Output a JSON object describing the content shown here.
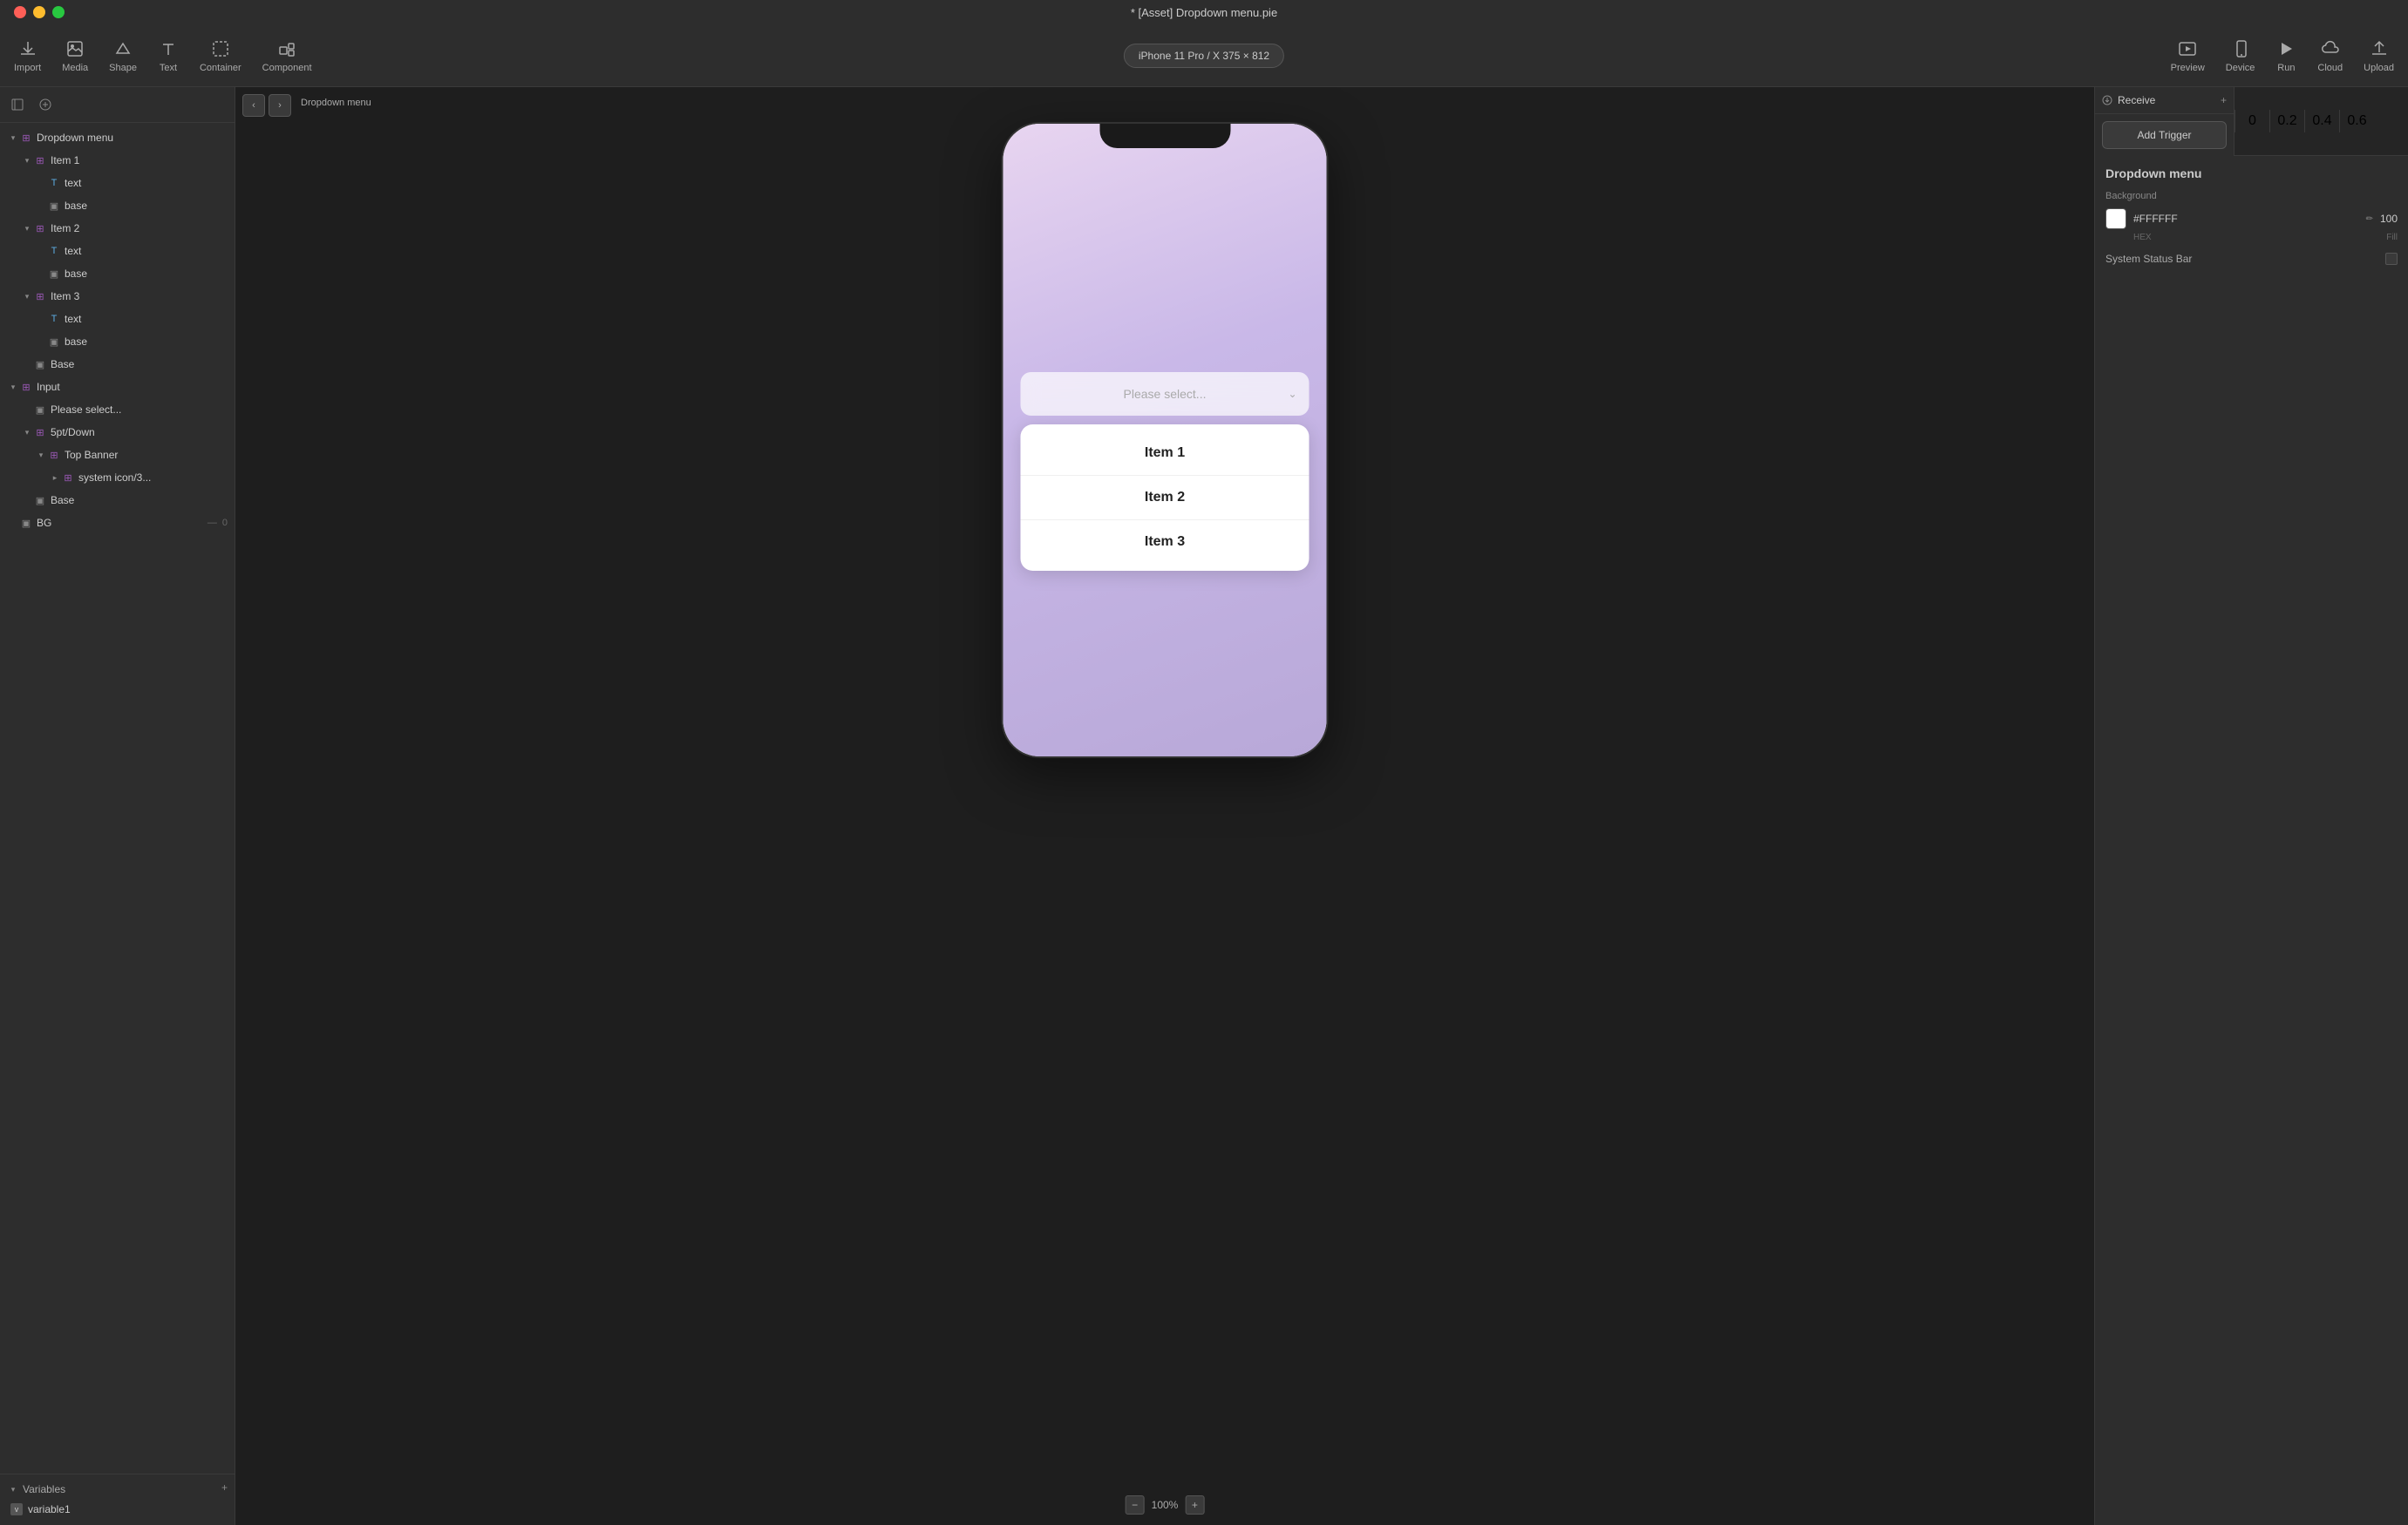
{
  "window": {
    "title": "* [Asset] Dropdown menu.pie"
  },
  "toolbar": {
    "import_label": "Import",
    "media_label": "Media",
    "shape_label": "Shape",
    "text_label": "Text",
    "container_label": "Container",
    "component_label": "Component",
    "device_label": "iPhone 11 Pro / X  375 × 812",
    "preview_label": "Preview",
    "device_btn_label": "Device",
    "run_label": "Run",
    "cloud_label": "Cloud",
    "upload_label": "Upload"
  },
  "layers": {
    "root_label": "Dropdown menu",
    "items": [
      {
        "label": "Item 1",
        "type": "component",
        "indent": 1,
        "expanded": true
      },
      {
        "label": "text",
        "type": "text",
        "indent": 2,
        "expanded": false
      },
      {
        "label": "base",
        "type": "frame",
        "indent": 2,
        "expanded": false
      },
      {
        "label": "Item 2",
        "type": "component",
        "indent": 1,
        "expanded": true
      },
      {
        "label": "text",
        "type": "text",
        "indent": 2,
        "expanded": false
      },
      {
        "label": "base",
        "type": "frame",
        "indent": 2,
        "expanded": false
      },
      {
        "label": "Item 3",
        "type": "component",
        "indent": 1,
        "expanded": true
      },
      {
        "label": "text",
        "type": "text",
        "indent": 2,
        "expanded": false
      },
      {
        "label": "base",
        "type": "frame",
        "indent": 2,
        "expanded": false
      },
      {
        "label": "Base",
        "type": "frame",
        "indent": 1,
        "expanded": false
      },
      {
        "label": "Input",
        "type": "component",
        "indent": 0,
        "expanded": true
      },
      {
        "label": "Please select...",
        "type": "frame",
        "indent": 1,
        "expanded": false
      },
      {
        "label": "5pt/Down",
        "type": "component",
        "indent": 1,
        "expanded": true
      },
      {
        "label": "Top Banner",
        "type": "component",
        "indent": 2,
        "expanded": true
      },
      {
        "label": "system icon/3...",
        "type": "component",
        "indent": 3,
        "expanded": false
      },
      {
        "label": "Base",
        "type": "frame",
        "indent": 1,
        "expanded": false
      },
      {
        "label": "BG",
        "type": "frame",
        "indent": 0,
        "expanded": false
      }
    ]
  },
  "variables": {
    "label": "Variables",
    "items": [
      {
        "label": "variable1"
      }
    ]
  },
  "canvas": {
    "label": "Dropdown menu",
    "zoom": "100%",
    "device_display": "iPhone 11 Pro / X  375 × 812"
  },
  "phone": {
    "dropdown_placeholder": "Please select...",
    "items": [
      {
        "label": "Item 1"
      },
      {
        "label": "Item 2"
      },
      {
        "label": "Item 3"
      }
    ]
  },
  "receive": {
    "label": "Receive",
    "add_trigger_label": "Add Trigger"
  },
  "timeline": {
    "ticks": [
      "0",
      "0.2",
      "0.4",
      "0.6"
    ]
  },
  "properties": {
    "title": "Dropdown menu",
    "background_label": "Background",
    "color_hex": "#FFFFFF",
    "hex_label": "HEX",
    "fill_label": "Fill",
    "opacity": "100",
    "system_status_bar_label": "System Status Bar"
  }
}
